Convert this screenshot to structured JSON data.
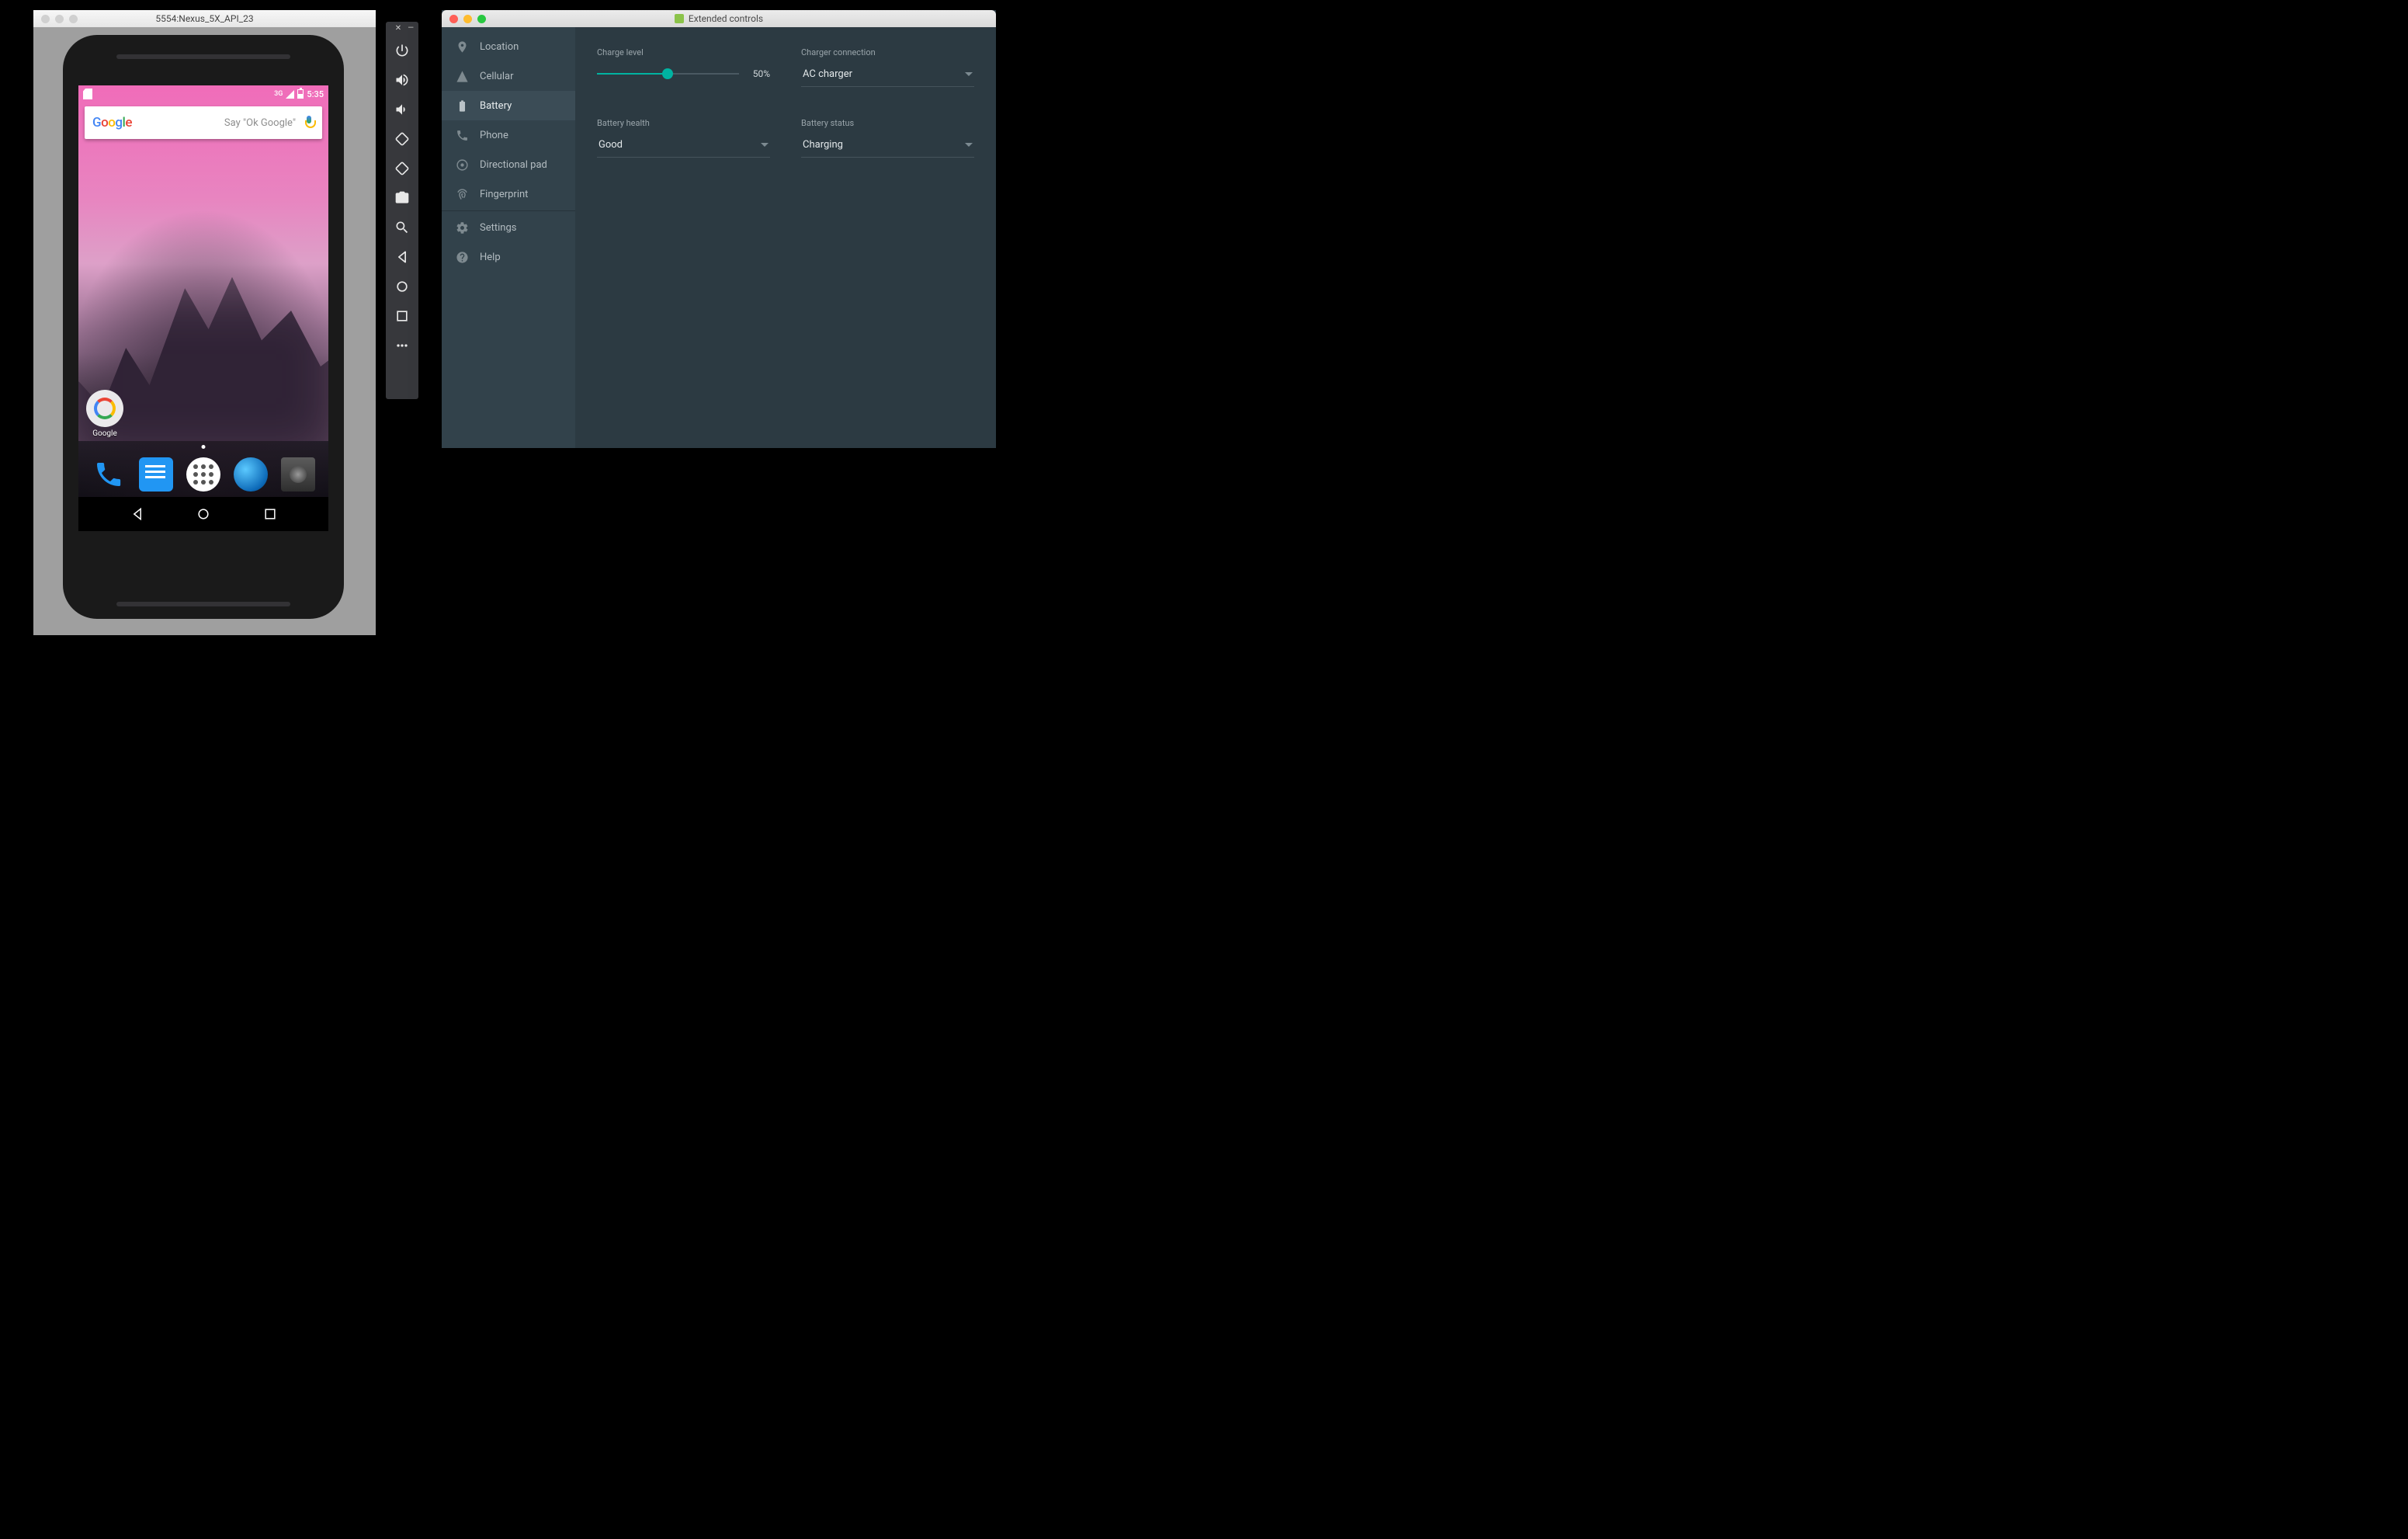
{
  "emulator": {
    "window_title": "5554:Nexus_5X_API_23",
    "status": {
      "net": "3G",
      "time": "5:35"
    },
    "search_placeholder": "Say \"Ok Google\"",
    "folder_label": "Google",
    "dock_icons": [
      "phone-icon",
      "messages-icon",
      "apps-icon",
      "browser-icon",
      "camera-icon"
    ]
  },
  "toolbar_icons": [
    "power-icon",
    "volume-up-icon",
    "volume-down-icon",
    "rotate-left-icon",
    "rotate-right-icon",
    "screenshot-icon",
    "zoom-icon",
    "back-icon",
    "home-icon",
    "overview-icon",
    "more-icon"
  ],
  "extended": {
    "title": "Extended controls",
    "sidebar": [
      {
        "icon": "location-icon",
        "label": "Location"
      },
      {
        "icon": "cellular-icon",
        "label": "Cellular"
      },
      {
        "icon": "battery-icon",
        "label": "Battery",
        "selected": true
      },
      {
        "icon": "phone-icon",
        "label": "Phone"
      },
      {
        "icon": "dpad-icon",
        "label": "Directional pad"
      },
      {
        "icon": "fingerprint-icon",
        "label": "Fingerprint"
      },
      {
        "icon": "settings-icon",
        "label": "Settings"
      },
      {
        "icon": "help-icon",
        "label": "Help"
      }
    ],
    "controls": {
      "charge_level_label": "Charge level",
      "charge_level_value": "50%",
      "charge_level_pct": 50,
      "charger_conn_label": "Charger connection",
      "charger_conn_value": "AC charger",
      "battery_health_label": "Battery health",
      "battery_health_value": "Good",
      "battery_status_label": "Battery status",
      "battery_status_value": "Charging"
    }
  }
}
